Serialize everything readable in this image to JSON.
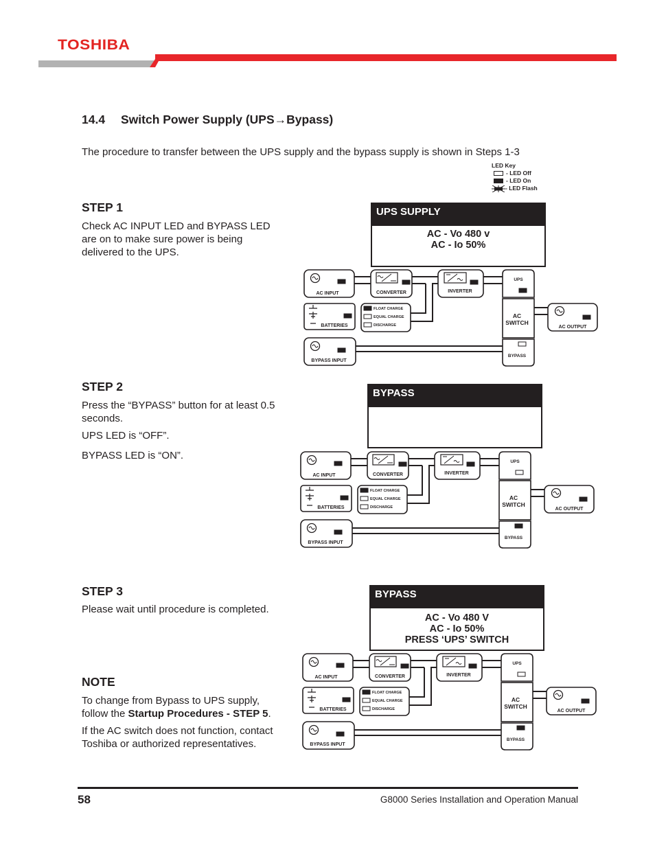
{
  "header": {
    "brand": "TOSHIBA",
    "colors": {
      "brand_red": "#e8262a",
      "band_gray": "#b2b2b2",
      "ink": "#231f20"
    }
  },
  "section": {
    "number": "14.4",
    "title": "Switch Power Supply (UPS→Bypass)",
    "intro": "The procedure to transfer between the UPS supply and the bypass supply is shown in Steps 1-3"
  },
  "led_key": {
    "title": "LED Key",
    "items": [
      {
        "state": "off",
        "label": "- LED Off"
      },
      {
        "state": "on",
        "label": "- LED On"
      },
      {
        "state": "flash",
        "label": "- LED Flash"
      }
    ]
  },
  "steps": [
    {
      "title": "STEP 1",
      "paragraphs": [
        "Check AC INPUT LED and BYPASS LED are on to make sure power is being delivered to the UPS."
      ],
      "display": {
        "header": "UPS SUPPLY",
        "lines": [
          "AC - Vo 480 v",
          "AC - Io  50%"
        ]
      },
      "leds": {
        "ac_input": "on",
        "converter": "on",
        "inverter": "on",
        "ups": "on",
        "batteries": "on",
        "float_charge": "on",
        "equal_charge": "off",
        "discharge": "off",
        "ac_output": "on",
        "bypass_input": "on",
        "bypass": "off"
      }
    },
    {
      "title": "STEP 2",
      "paragraphs": [
        "Press the “BYPASS” button for at least 0.5 seconds.",
        "UPS LED is “OFF”.",
        "BYPASS LED is  “ON”."
      ],
      "display": {
        "header": "BYPASS",
        "lines": []
      },
      "leds": {
        "ac_input": "on",
        "converter": "on",
        "inverter": "on",
        "ups": "off",
        "batteries": "on",
        "float_charge": "on",
        "equal_charge": "off",
        "discharge": "off",
        "ac_output": "on",
        "bypass_input": "on",
        "bypass": "on"
      }
    },
    {
      "title": "STEP 3",
      "paragraphs": [
        "Please wait until procedure is completed."
      ],
      "display": {
        "header": "BYPASS",
        "lines": [
          "AC - Vo 480 V",
          "AC - Io  50%",
          "PRESS ‘UPS’ SWITCH"
        ]
      },
      "leds": {
        "ac_input": "on",
        "converter": "on",
        "inverter": "on",
        "ups": "off",
        "batteries": "on",
        "float_charge": "on",
        "equal_charge": "off",
        "discharge": "off",
        "ac_output": "on",
        "bypass_input": "on",
        "bypass": "on"
      }
    }
  ],
  "diagram_labels": {
    "ac_input": "AC INPUT",
    "converter": "CONVERTER",
    "inverter": "INVERTER",
    "ups": "UPS",
    "ac_switch_1": "AC",
    "ac_switch_2": "SWITCH",
    "ac_output": "AC OUTPUT",
    "batteries": "BATTERIES",
    "float_charge": "FLOAT CHARGE",
    "equal_charge": "EQUAL CHARGE",
    "discharge": "DISCHARGE",
    "bypass_input": "BYPASS INPUT",
    "bypass": "BYPASS"
  },
  "note": {
    "title": "NOTE",
    "p1_pre": "To change from Bypass to UPS supply, follow the ",
    "p1_bold": "Startup Procedures - STEP 5",
    "p1_post": ".",
    "p2": "If the AC switch does not function, contact Toshiba or authorized representatives."
  },
  "footer": {
    "page_number": "58",
    "manual_title": "G8000 Series Installation and Operation Manual"
  }
}
